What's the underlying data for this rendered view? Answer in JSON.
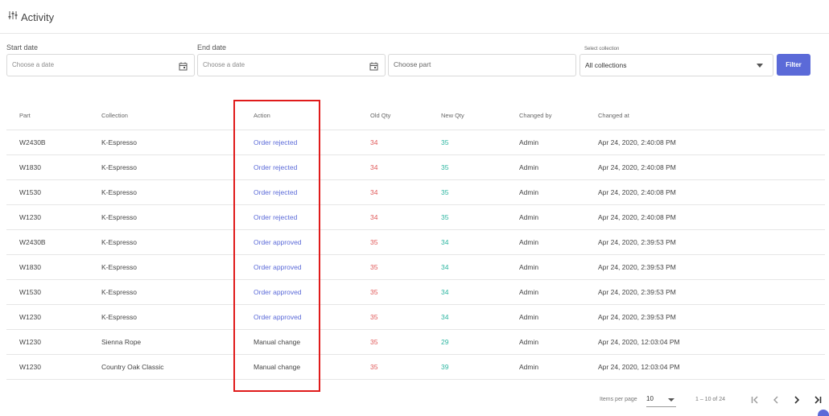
{
  "header": {
    "title": "Activity",
    "icon": "sliders-icon"
  },
  "filters": {
    "start_date": {
      "label": "Start date",
      "placeholder": "Choose a date"
    },
    "end_date": {
      "label": "End date",
      "placeholder": "Choose a date"
    },
    "part": {
      "placeholder": "Choose part"
    },
    "collection": {
      "label": "Select collection",
      "value": "All collections"
    },
    "filter_button": "Filter"
  },
  "table": {
    "columns": [
      "Part",
      "Collection",
      "Action",
      "Old Qty",
      "New Qty",
      "Changed by",
      "Changed at"
    ],
    "rows": [
      {
        "part": "W2430B",
        "collection": "K-Espresso",
        "action": "Order rejected",
        "old_qty": "34",
        "new_qty": "35",
        "changed_by": "Admin",
        "changed_at": "Apr 24, 2020, 2:40:08 PM"
      },
      {
        "part": "W1830",
        "collection": "K-Espresso",
        "action": "Order rejected",
        "old_qty": "34",
        "new_qty": "35",
        "changed_by": "Admin",
        "changed_at": "Apr 24, 2020, 2:40:08 PM"
      },
      {
        "part": "W1530",
        "collection": "K-Espresso",
        "action": "Order rejected",
        "old_qty": "34",
        "new_qty": "35",
        "changed_by": "Admin",
        "changed_at": "Apr 24, 2020, 2:40:08 PM"
      },
      {
        "part": "W1230",
        "collection": "K-Espresso",
        "action": "Order rejected",
        "old_qty": "34",
        "new_qty": "35",
        "changed_by": "Admin",
        "changed_at": "Apr 24, 2020, 2:40:08 PM"
      },
      {
        "part": "W2430B",
        "collection": "K-Espresso",
        "action": "Order approved",
        "old_qty": "35",
        "new_qty": "34",
        "changed_by": "Admin",
        "changed_at": "Apr 24, 2020, 2:39:53 PM"
      },
      {
        "part": "W1830",
        "collection": "K-Espresso",
        "action": "Order approved",
        "old_qty": "35",
        "new_qty": "34",
        "changed_by": "Admin",
        "changed_at": "Apr 24, 2020, 2:39:53 PM"
      },
      {
        "part": "W1530",
        "collection": "K-Espresso",
        "action": "Order approved",
        "old_qty": "35",
        "new_qty": "34",
        "changed_by": "Admin",
        "changed_at": "Apr 24, 2020, 2:39:53 PM"
      },
      {
        "part": "W1230",
        "collection": "K-Espresso",
        "action": "Order approved",
        "old_qty": "35",
        "new_qty": "34",
        "changed_by": "Admin",
        "changed_at": "Apr 24, 2020, 2:39:53 PM"
      },
      {
        "part": "W1230",
        "collection": "Sienna Rope",
        "action": "Manual change",
        "old_qty": "35",
        "new_qty": "29",
        "changed_by": "Admin",
        "changed_at": "Apr 24, 2020, 12:03:04 PM"
      },
      {
        "part": "W1230",
        "collection": "Country Oak Classic",
        "action": "Manual change",
        "old_qty": "35",
        "new_qty": "39",
        "changed_by": "Admin",
        "changed_at": "Apr 24, 2020, 12:03:04 PM"
      }
    ]
  },
  "paginator": {
    "items_per_page_label": "Items per page",
    "items_per_page": "10",
    "range": "1 – 10 of 24"
  },
  "colors": {
    "accent": "#5b6ad8",
    "old_qty": "#e05a5a",
    "new_qty": "#2bb5a0",
    "highlight": "#e01b1b"
  }
}
